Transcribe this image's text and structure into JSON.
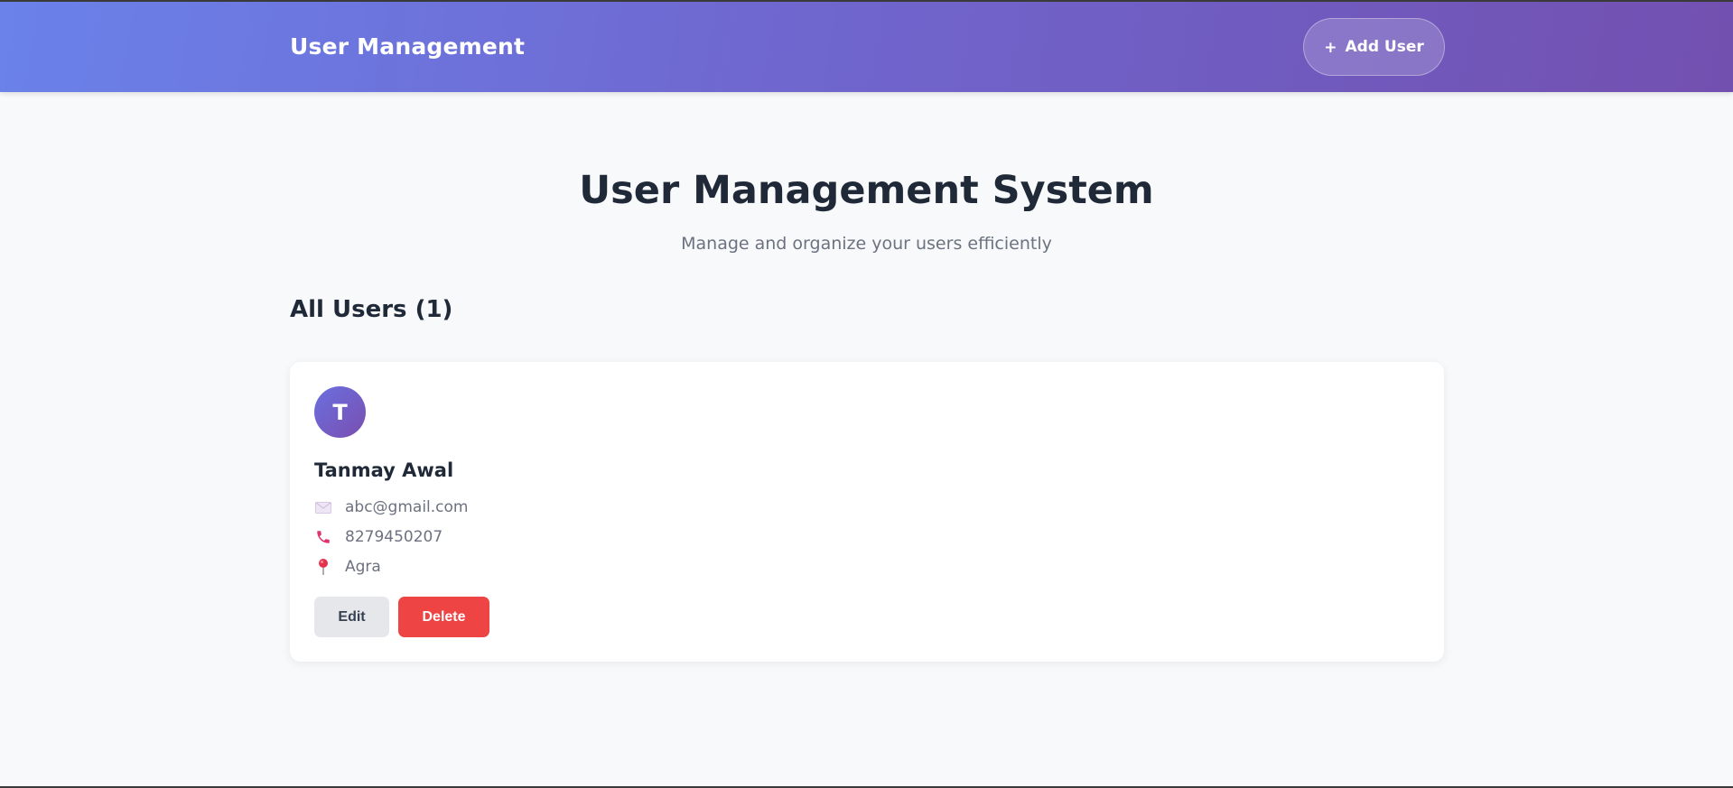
{
  "header": {
    "brand": "User Management",
    "add_user": {
      "icon": "plus-icon",
      "symbol": "+",
      "label": "Add User"
    }
  },
  "hero": {
    "title": "User Management System",
    "subtitle": "Manage and organize your users efficiently"
  },
  "users_section": {
    "title": "All Users (1)"
  },
  "users": [
    {
      "avatar_initial": "T",
      "name": "Tanmay Awal",
      "email": "abc@gmail.com",
      "email_icon": "envelope-icon",
      "phone": "8279450207",
      "phone_icon": "phone-icon",
      "city": "Agra",
      "city_icon": "map-pin-icon",
      "edit_label": "Edit",
      "delete_label": "Delete"
    }
  ],
  "colors": {
    "header_gradient_start": "#6a82ea",
    "header_gradient_end": "#7250b0",
    "delete": "#ef4444",
    "edit": "#e5e7eb",
    "background": "#f8f9fb"
  }
}
